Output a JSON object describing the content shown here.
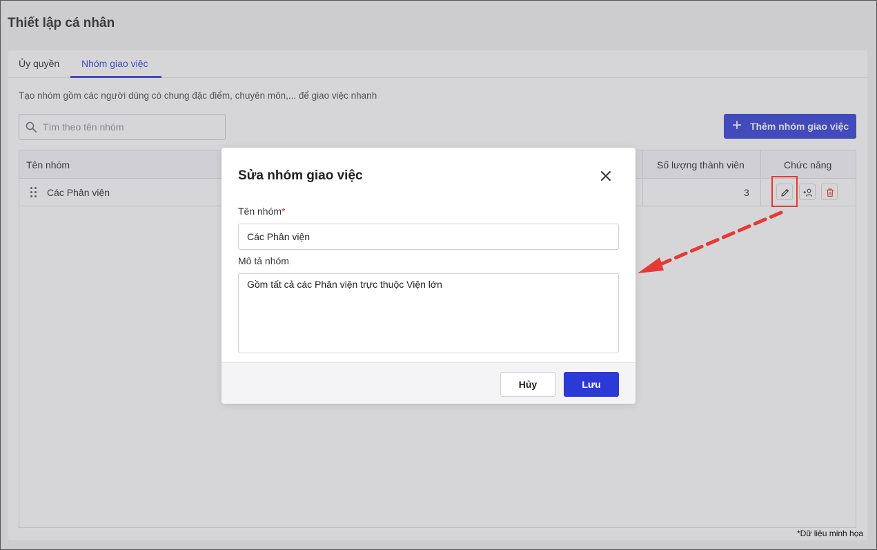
{
  "page": {
    "title": "Thiết lập cá nhân"
  },
  "tabs": [
    {
      "label": "Ủy quyền",
      "active": false
    },
    {
      "label": "Nhóm giao việc",
      "active": true
    }
  ],
  "description": "Tạo nhóm gồm các người dùng có chung đặc điểm, chuyên môn,... để giao việc nhanh",
  "search": {
    "placeholder": "Tìm theo tên nhóm",
    "value": "",
    "icon": "search-icon"
  },
  "add_button": {
    "label": "Thêm nhóm giao việc",
    "icon": "plus-icon"
  },
  "table": {
    "columns": [
      "Tên nhóm",
      "Số lượng thành viên",
      "Chức năng"
    ],
    "rows": [
      {
        "name": "Các Phân viện",
        "member_count": "3",
        "actions": [
          "edit-icon",
          "add-member-icon",
          "trash-icon"
        ]
      }
    ]
  },
  "modal": {
    "title": "Sửa nhóm giao việc",
    "name_label": "Tên nhóm",
    "required_mark": "*",
    "name_value": "Các Phân viện",
    "desc_label": "Mô tả nhóm",
    "desc_value": "Gồm tất cả các Phân viện trực thuộc Viện lớn",
    "cancel_label": "Hủy",
    "save_label": "Lưu"
  },
  "footnote": "*Dữ liệu minh họa",
  "colors": {
    "primary": "#2b39d6",
    "annotation": "#e53935",
    "danger": "#d93025"
  }
}
